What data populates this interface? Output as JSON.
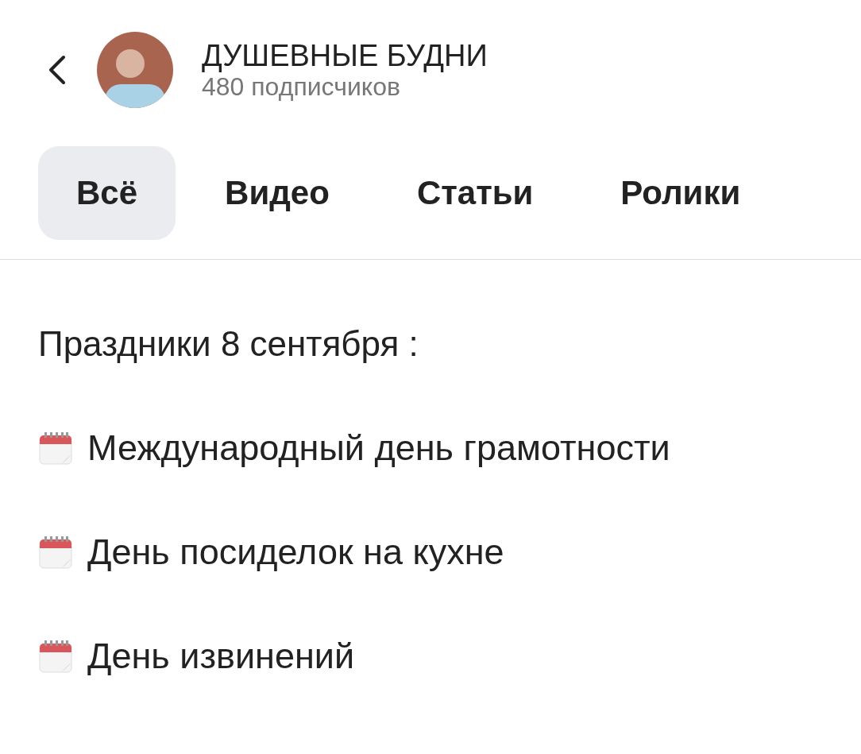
{
  "channel": {
    "name": "ДУШЕВНЫЕ БУДНИ",
    "subscribers": "480 подписчиков"
  },
  "tabs": [
    {
      "label": "Всё",
      "selected": true
    },
    {
      "label": "Видео",
      "selected": false
    },
    {
      "label": "Статьи",
      "selected": false
    },
    {
      "label": "Ролики",
      "selected": false
    }
  ],
  "post": {
    "heading": "Праздники 8 сентября :",
    "items": [
      {
        "text": "Международный день грамотности"
      },
      {
        "text": "День посиделок на кухне"
      },
      {
        "text": "День извинений"
      }
    ]
  }
}
